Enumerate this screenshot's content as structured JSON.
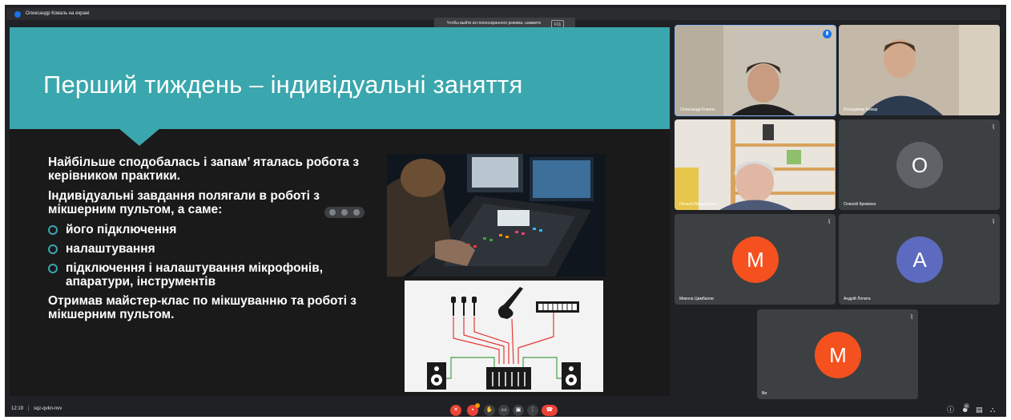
{
  "meeting": {
    "presenter_label": "Олександр Коваль на екрані",
    "fullscreen_hint": "Чтобы выйти из полноэкранного режима, нажмите",
    "fullscreen_key": "F11",
    "time": "12:19",
    "separator": "|",
    "meeting_code": "sqz-qvkn-nvv"
  },
  "slide": {
    "title": "Перший тиждень – індивідуальні заняття",
    "paragraphs": [
      "Найбільше сподобалась і запам’ яталась робота з керівником практики.",
      "Індивідуальні завдання полягали в роботі з мікшерним пультом, а саме:"
    ],
    "bullets": [
      "його підключення",
      "налаштування",
      "підключення і налаштування мікрофонів, апаратури, інструментів"
    ],
    "closing": "Отримав майстер-клас по мікшуванню та роботі з мікшерним пультом."
  },
  "participants": [
    {
      "name": "Олександр Коваль",
      "type": "camera"
    },
    {
      "name": "Володимир Комар",
      "type": "camera"
    },
    {
      "name": "Наталія Марищенко",
      "type": "camera"
    },
    {
      "name": "Олексій Кремінко",
      "type": "avatar",
      "initial": "O",
      "color": "#5f6368"
    },
    {
      "name": "Микола Цимбалов",
      "type": "avatar",
      "initial": "M",
      "color": "#f4511e"
    },
    {
      "name": "Андрій Лопата",
      "type": "avatar",
      "initial": "A",
      "color": "#5c6bc0"
    },
    {
      "name": "Ви",
      "type": "avatar",
      "initial": "M",
      "color": "#f4511e"
    }
  ],
  "controls": {
    "left_icons": [
      "mic-off-icon",
      "camera-off-icon",
      "raise-hand-icon",
      "captions-icon",
      "present-icon",
      "more-options-icon",
      "end-call-icon"
    ],
    "right_icons": [
      "info-icon",
      "people-icon",
      "chat-icon",
      "activities-icon"
    ],
    "people_count": "8"
  },
  "colors": {
    "accent_teal": "#3aa6ad",
    "end_call_red": "#ea4335",
    "meet_blue": "#1a73e8"
  }
}
